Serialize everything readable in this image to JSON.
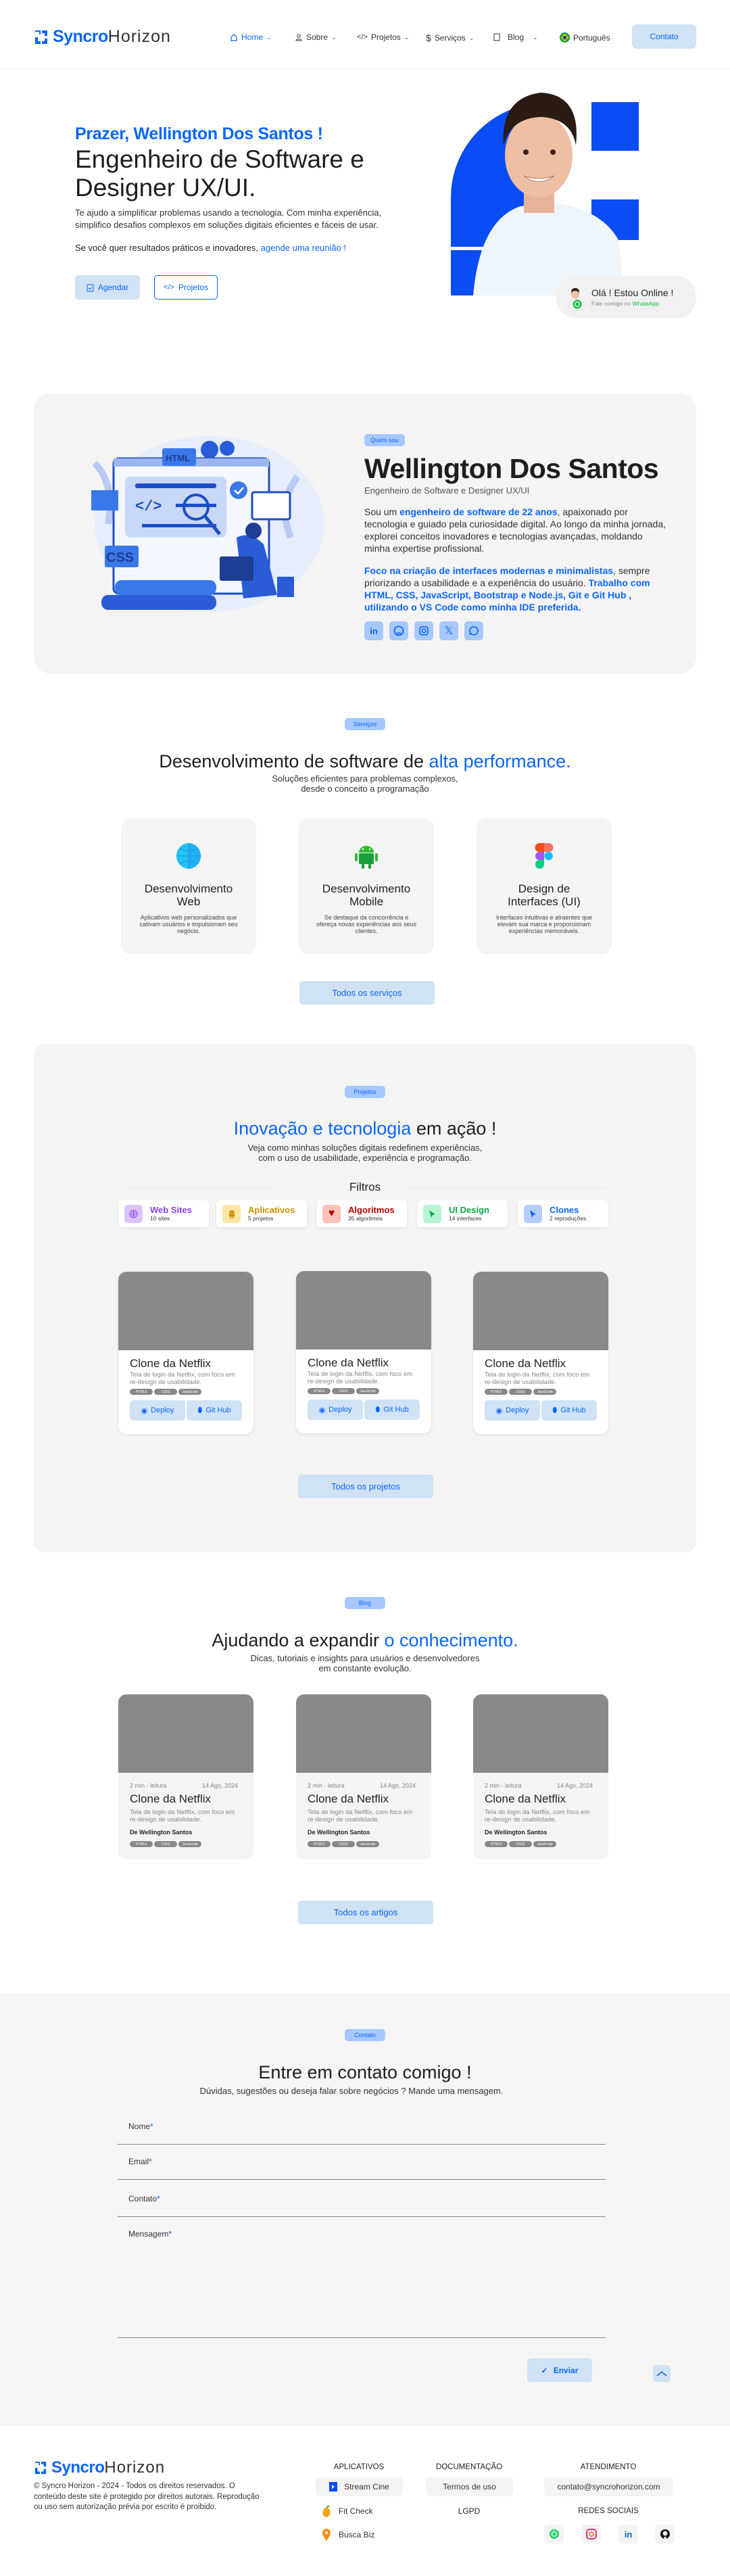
{
  "colors": {
    "accent": "#0a66ff",
    "pill": "#a6c8ff",
    "button": "#d0e2f4",
    "section_bg": "#f4f4f4"
  },
  "nav": {
    "logo_bold": "Syncro",
    "logo_light": "Horizon",
    "items": [
      {
        "label": "Home",
        "icon": "home-icon"
      },
      {
        "label": "Sobre",
        "icon": "user-icon"
      },
      {
        "label": "Projetos",
        "icon": "code-icon"
      },
      {
        "label": "Serviços",
        "icon": "dollar-icon"
      },
      {
        "label": "Blog",
        "icon": "document-icon"
      }
    ],
    "language": "Português",
    "contact": "Contato"
  },
  "hero": {
    "greeting": "Prazer, Wellington Dos Santos !",
    "title_line1": "Engenheiro de Software e",
    "title_line2": "Designer UX/UI.",
    "description": "Te ajudo a simplificar problemas usando a tecnologia. Com minha experiência, simplifico desafios complexos em soluções digitais eficientes e fáceis de usar.",
    "cta_text": "Se você quer resultados práticos e inovadores, ",
    "cta_link": "agende uma reunião !",
    "btn_schedule": "Agendar",
    "btn_projects": "Projetos",
    "whatsapp": {
      "title": "Olá ! Estou Online !",
      "sub_prefix": "Fale comigo no ",
      "sub_link": "WhatsApp."
    }
  },
  "about": {
    "pill": "Quem sou",
    "name": "Wellington Dos Santos",
    "role": "Engenheiro de Software e Designer UX/UI",
    "p1_a": "Sou um ",
    "p1_b": "engenheiro de software de 22 anos",
    "p1_c": ", apaixonado por tecnologia e guiado pela curiosidade digital. Ao longo da minha jornada, explorei conceitos inovadores e tecnologias avançadas, moldando minha expertise profissional.",
    "p2_a": "Foco na criação de interfaces modernas e minimalistas",
    "p2_b": ", sempre priorizando a usabilidade e a experiência do usuário. ",
    "p2_c": "Trabalho com HTML, CSS, JavaScript, Bootstrap e Node.js, Git e Git Hub , utilizando o VS Code como minha IDE preferida.",
    "illustration_labels": [
      "HTML",
      "CSS",
      "</>"
    ],
    "socials": [
      "linkedin",
      "github",
      "instagram",
      "x",
      "whatsapp"
    ]
  },
  "services": {
    "pill": "Serviços",
    "title_a": "Desenvolvimento de software de ",
    "title_b": "alta performance.",
    "sub1": "Soluções eficientes para problemas complexos,",
    "sub2": "desde o conceito a programação",
    "cards": [
      {
        "title1": "Desenvolvimento",
        "title2": "Web",
        "desc": "Aplicativos web personalizados que cativam usuários e impulsionam seu negócio.",
        "icon": "globe-icon"
      },
      {
        "title1": "Desenvolvimento",
        "title2": "Mobile",
        "desc": "Se destaque da concorrência e ofereça novas experiências aos seus clientes.",
        "icon": "android-icon"
      },
      {
        "title1": "Design de",
        "title2": "Interfaces (UI)",
        "desc": "Interfaces intuitivas e atraentes que elevam sua marca e proporcionam experiências memoráveis.",
        "icon": "figma-icon"
      }
    ],
    "button": "Todos os serviços"
  },
  "projects": {
    "pill": "Projetos",
    "title_a": "Inovação e tecnologia",
    "title_b": " em ação !",
    "sub1": "Veja como minhas soluções digitais redefinem experiências,",
    "sub2": "com o uso de usabilidade, experiência e programação.",
    "filters_label": "Filtros",
    "filters": [
      {
        "title": "Web Sites",
        "count": "10 sites",
        "color": "#8b3ff0",
        "bg": "#dcc4ff"
      },
      {
        "title": "Aplicativos",
        "count": "5 projetos",
        "color": "#d18e00",
        "bg": "#ffe6a8"
      },
      {
        "title": "Algoritmos",
        "count": "35 algoritmos",
        "color": "#b30000",
        "bg": "#ffc2b8"
      },
      {
        "title": "UI Design",
        "count": "14 interfaces",
        "color": "#0aa84a",
        "bg": "#b6f5d2"
      },
      {
        "title": "Clones",
        "count": "2 reproduções",
        "color": "#0a66ff",
        "bg": "#b3cdff"
      }
    ],
    "cards": [
      {
        "title": "Clone da Netflix",
        "desc": "Tela de login da Netflix, com foco em re-design de usabilidade.",
        "tags": [
          "HTML5",
          "CSS3",
          "JavaScript"
        ],
        "deploy": "Deploy",
        "github": "Git Hub"
      },
      {
        "title": "Clone da Netflix",
        "desc": "Tela de login da Netflix, com foco em re-design de usabilidade.",
        "tags": [
          "HTML5",
          "CSS3",
          "JavaScript"
        ],
        "deploy": "Deploy",
        "github": "Git Hub"
      },
      {
        "title": "Clone da Netflix",
        "desc": "Tela de login da Netflix, com foco em re-design de usabilidade.",
        "tags": [
          "HTML5",
          "CSS3",
          "JavaScript"
        ],
        "deploy": "Deploy",
        "github": "Git Hub"
      }
    ],
    "button": "Todos os projetos"
  },
  "blog": {
    "pill": "Blog",
    "title_a": "Ajudando a expandir ",
    "title_b": "o conhecimento.",
    "sub1": "Dicas, tutoriais e insights para usuários e desenvolvedores",
    "sub2": "em constante evolução.",
    "posts": [
      {
        "read": "2 min - leitura",
        "date": "14 Ago, 2024",
        "title": "Clone da Netflix",
        "desc": "Tela de login da Netflix, com foco em re-design de usabilidade.",
        "author": "De Wellington Santos",
        "tags": [
          "HTML5",
          "CSS3",
          "JavaScript"
        ]
      },
      {
        "read": "2 min - leitura",
        "date": "14 Ago, 2024",
        "title": "Clone da Netflix",
        "desc": "Tela de login da Netflix, com foco em re-design de usabilidade.",
        "author": "De Wellington Santos",
        "tags": [
          "HTML5",
          "CSS3",
          "JavaScript"
        ]
      },
      {
        "read": "2 min - leitura",
        "date": "14 Ago, 2024",
        "title": "Clone da Netflix",
        "desc": "Tela de login da Netflix, com foco em re-design de usabilidade.",
        "author": "De Wellington Santos",
        "tags": [
          "HTML5",
          "CSS3",
          "JavaScript"
        ]
      }
    ],
    "button": "Todos os artigos"
  },
  "contact": {
    "pill": "Contato",
    "title": "Entre em contato comigo !",
    "sub": "Dúvidas, sugestões ou deseja falar sobre negócios ? Mande uma mensagem.",
    "fields": [
      {
        "label": "Nome"
      },
      {
        "label": "Email"
      },
      {
        "label": "Contato"
      },
      {
        "label": "Mensagem"
      }
    ],
    "required_mark": "*",
    "submit": "Enviar"
  },
  "footer": {
    "logo_bold": "Syncro",
    "logo_light": "Horizon",
    "copyright": "© Syncro Horizon - 2024 - Todos os direitos reservados. O conteúdo deste site é protegido por direitos autorais. Reprodução ou uso sem autorização prévia por escrito é proibido.",
    "apps_title": "APLICATIVOS",
    "apps": [
      "Stream Cine",
      "Fit Check",
      "Busca Biz"
    ],
    "docs_title": "DOCUMENTAÇÃO",
    "docs": [
      "Termos de uso",
      "LGPD"
    ],
    "support_title": "ATENDIMENTO",
    "email": "contato@syncrohorizon.com",
    "social_title": "REDES SOCIAIS",
    "socials": [
      "whatsapp",
      "instagram",
      "linkedin",
      "github"
    ]
  }
}
